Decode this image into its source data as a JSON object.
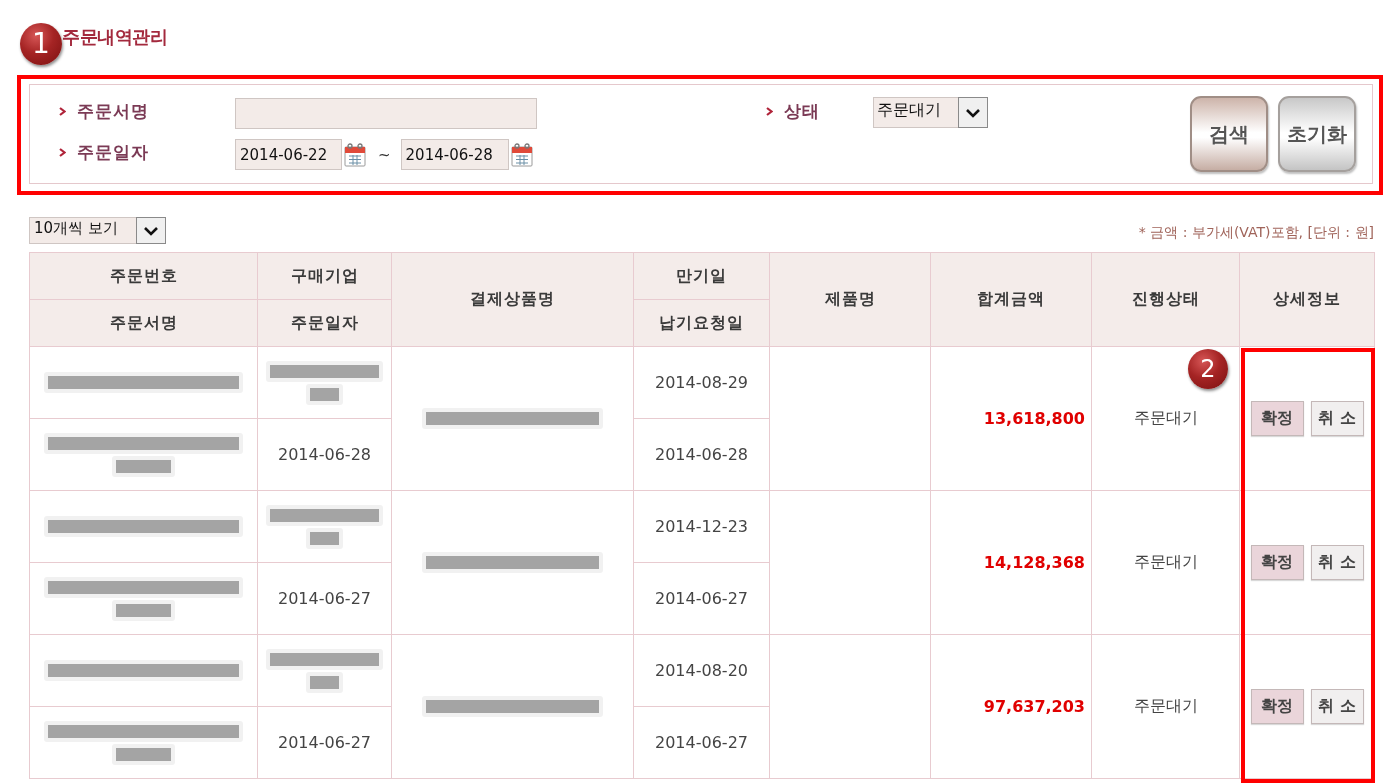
{
  "title": "주문내역관리",
  "callouts": [
    {
      "kind": "search-panel",
      "number": "1"
    },
    {
      "kind": "actions-column",
      "number": "2"
    }
  ],
  "search": {
    "fields": [
      {
        "kind": "text",
        "label": "주문서명"
      },
      {
        "kind": "date-range",
        "label": "주문일자",
        "from": "2014-06-22",
        "separator": "~",
        "to": "2014-06-28"
      },
      {
        "kind": "select",
        "label": "상태",
        "value": "주문대기"
      }
    ],
    "buttons": [
      {
        "kind": "search",
        "label": "검색"
      },
      {
        "kind": "reset",
        "label": "초기화"
      }
    ]
  },
  "list": {
    "page_size": "10개씩 보기",
    "note": "* 금액 : 부가세(VAT)포함, [단위 : 원]",
    "columns": [
      {
        "kind": "stacked",
        "top": "주문번호",
        "bottom": "주문서명"
      },
      {
        "kind": "stacked",
        "top": "구매기업",
        "bottom": "주문일자"
      },
      {
        "kind": "single",
        "label": "결제상품명"
      },
      {
        "kind": "stacked",
        "top": "만기일",
        "bottom": "납기요청일"
      },
      {
        "kind": "single",
        "label": "제품명"
      },
      {
        "kind": "single",
        "label": "합계금액"
      },
      {
        "kind": "single",
        "label": "진행상태"
      },
      {
        "kind": "single",
        "label": "상세정보"
      }
    ],
    "orders": [
      {
        "order_number": {
          "redacted": true
        },
        "order_name": {
          "redacted": true
        },
        "buyer": {
          "redacted": true
        },
        "order_date": "2014-06-28",
        "payment_product": {
          "redacted": true
        },
        "due_date": "2014-08-29",
        "delivery_request_date": "2014-06-28",
        "total": "13,618,800",
        "status": "주문대기",
        "actions": [
          {
            "kind": "confirm",
            "label": "확정"
          },
          {
            "kind": "cancel",
            "label": "취 소"
          }
        ]
      },
      {
        "order_number": {
          "redacted": true
        },
        "order_name": {
          "redacted": true
        },
        "buyer": {
          "redacted": true
        },
        "order_date": "2014-06-27",
        "payment_product": {
          "redacted": true
        },
        "due_date": "2014-12-23",
        "delivery_request_date": "2014-06-27",
        "total": "14,128,368",
        "status": "주문대기",
        "actions": [
          {
            "kind": "confirm",
            "label": "확정"
          },
          {
            "kind": "cancel",
            "label": "취 소"
          }
        ]
      },
      {
        "order_number": {
          "redacted": true
        },
        "order_name": {
          "redacted": true
        },
        "buyer": {
          "redacted": true
        },
        "order_date": "2014-06-27",
        "payment_product": {
          "redacted": true
        },
        "due_date": "2014-08-20",
        "delivery_request_date": "2014-06-27",
        "total": "97,637,203",
        "status": "주문대기",
        "actions": [
          {
            "kind": "confirm",
            "label": "확정"
          },
          {
            "kind": "cancel",
            "label": "취 소"
          }
        ]
      }
    ]
  }
}
